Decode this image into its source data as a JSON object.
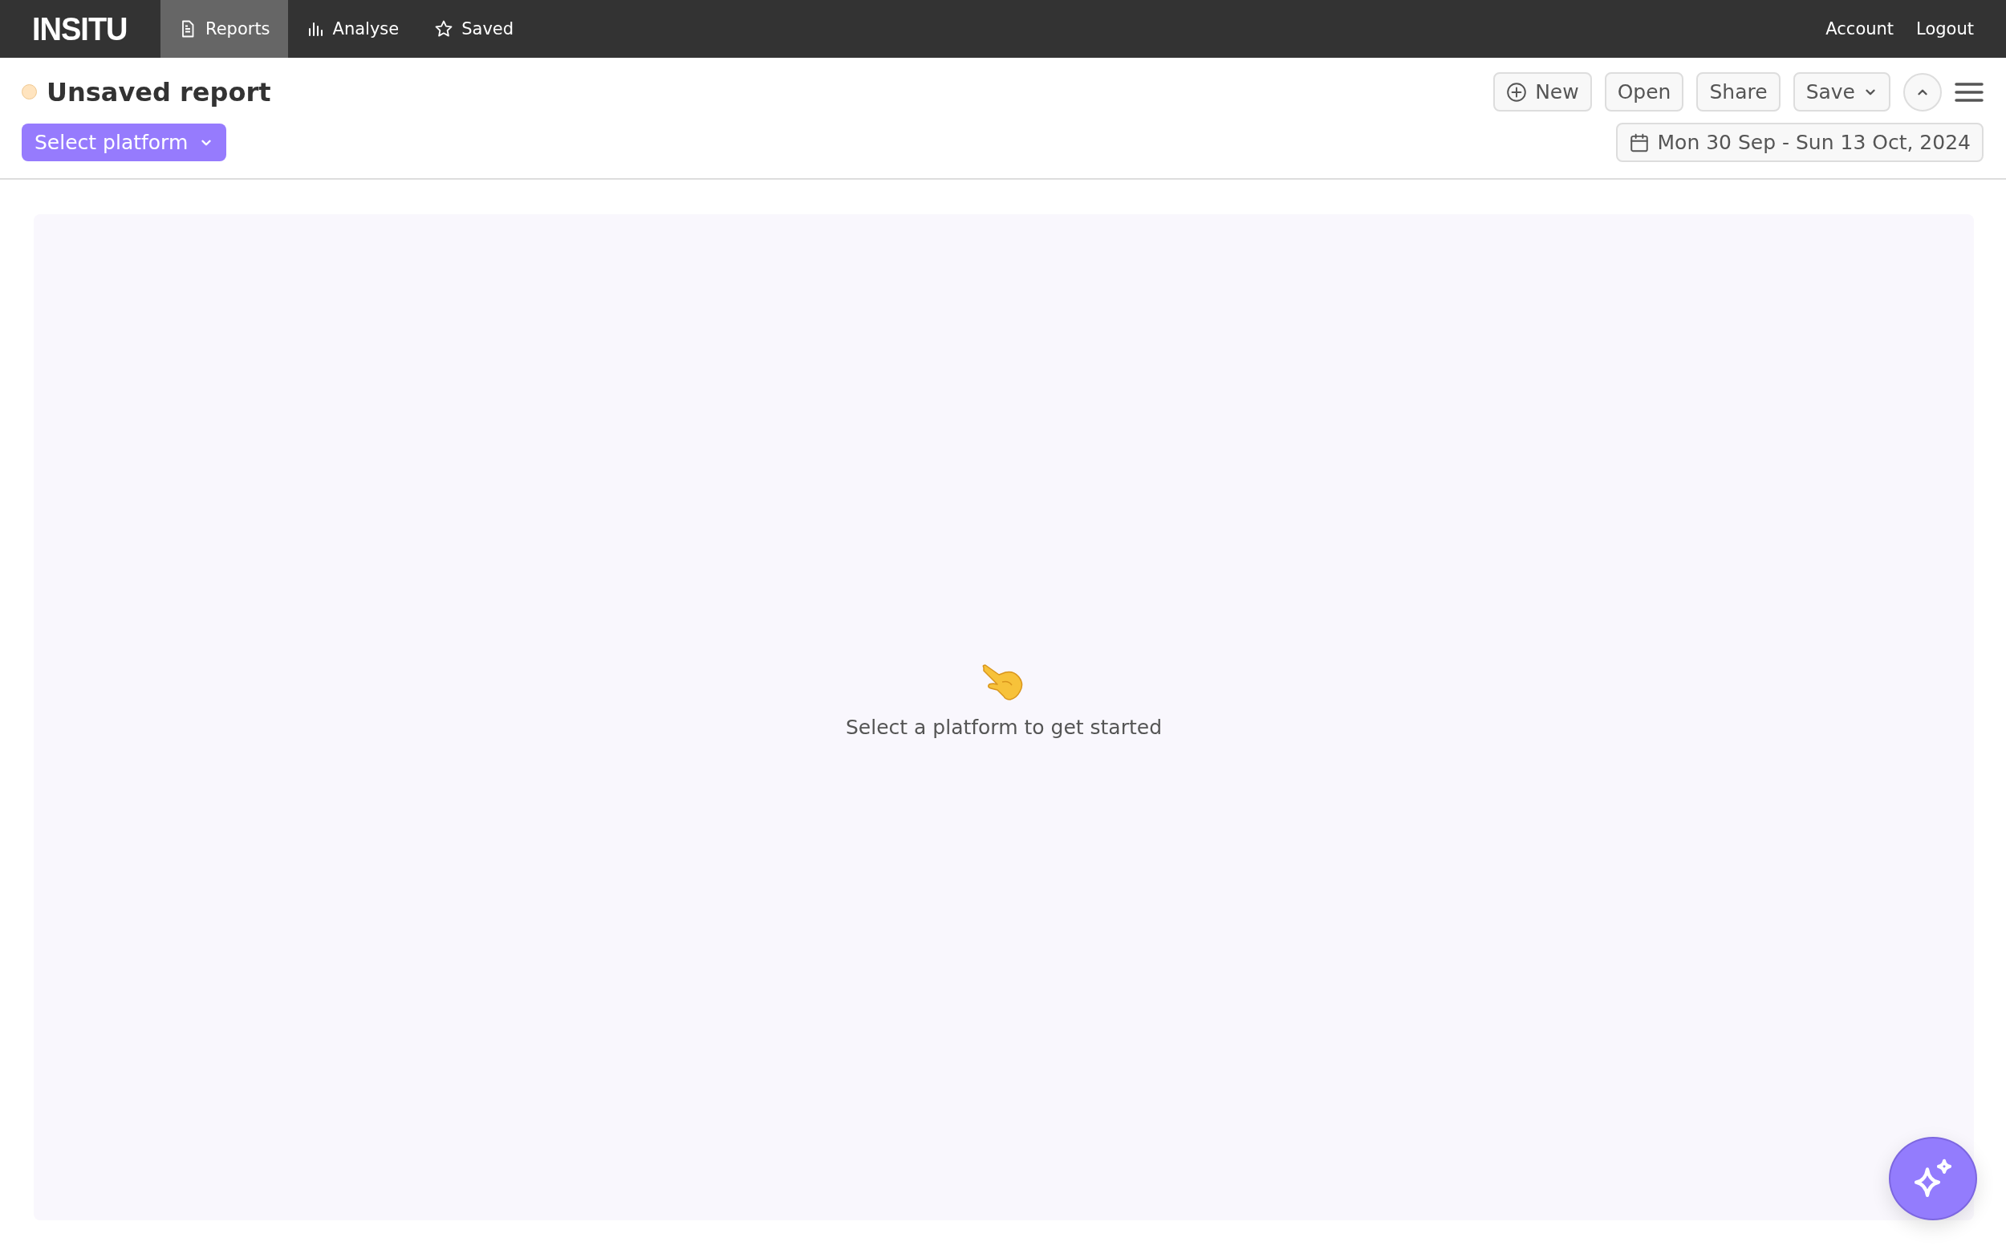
{
  "navbar": {
    "logo": "INSITU",
    "tabs": [
      {
        "label": "Reports",
        "kind": "document",
        "selected": true
      },
      {
        "label": "Analyse",
        "kind": "chart",
        "selected": false
      },
      {
        "label": "Saved",
        "kind": "star",
        "selected": false
      }
    ],
    "links": [
      "Account",
      "Logout"
    ]
  },
  "header": {
    "title": "Unsaved report",
    "platform_button": "Select platform",
    "actions": [
      {
        "label": "New",
        "kind": "plus"
      },
      {
        "label": "Open",
        "kind": "plain"
      },
      {
        "label": "Share",
        "kind": "plain"
      },
      {
        "label": "Save",
        "kind": "dropdown"
      }
    ],
    "date_range": "Mon 30 Sep - Sun 13 Oct, 2024"
  },
  "empty_state": {
    "message": "Select a platform to get started"
  }
}
